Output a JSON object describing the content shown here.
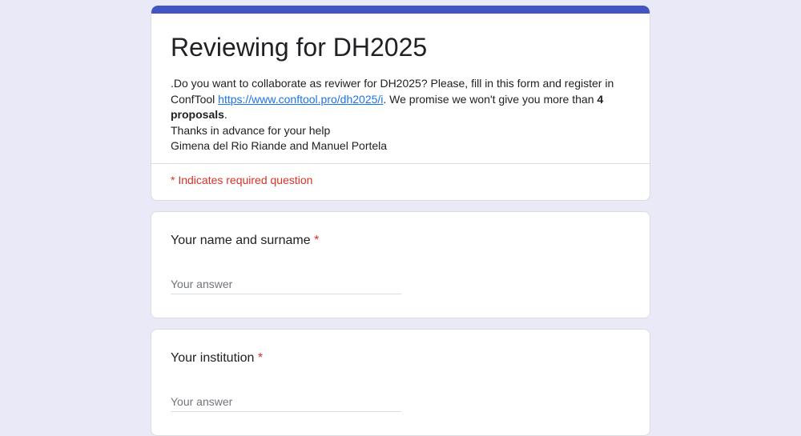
{
  "form": {
    "title": "Reviewing for DH2025",
    "description": {
      "line1_prefix": ".Do you want to  collaborate as reviwer for DH2025? Please, fill in this form and register in ConfTool ",
      "link_text": "https://www.conftool.pro/dh2025/i",
      "line1_suffix": ". We promise we won't give you more than ",
      "bold_text": "4 proposals",
      "period": ".",
      "line2": "Thanks in advance for your help",
      "line3": "Gimena del Rio Riande and Manuel Portela"
    },
    "required_note": "* Indicates required question",
    "accent_color": "#4255c2",
    "required_color": "#d93025"
  },
  "questions": [
    {
      "label": "Your name and surname",
      "required_mark": "*",
      "placeholder": "Your answer"
    },
    {
      "label": "Your institution",
      "required_mark": "*",
      "placeholder": "Your answer"
    }
  ]
}
